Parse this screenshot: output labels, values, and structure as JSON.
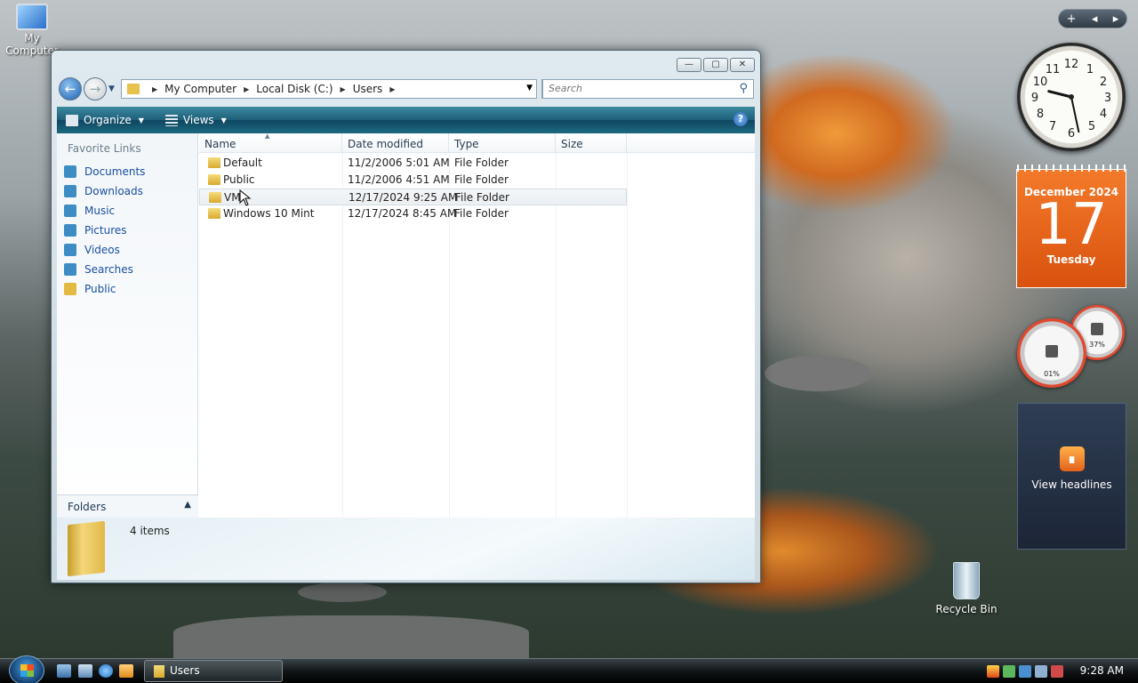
{
  "desktop": {
    "icons": [
      {
        "label": "My Computer"
      },
      {
        "label": "Recycle Bin"
      }
    ]
  },
  "window": {
    "title": "Users",
    "buttons": {
      "minimize": "—",
      "maximize": "▢",
      "close": "✕"
    },
    "address": {
      "crumbs": [
        "My Computer",
        "Local Disk (C:)",
        "Users"
      ]
    },
    "search_placeholder": "Search",
    "toolbar": {
      "organize": "Organize",
      "views": "Views",
      "help": "?"
    },
    "favorite_links": {
      "title": "Favorite Links",
      "items": [
        {
          "label": "Documents",
          "color": "#3d8cc4"
        },
        {
          "label": "Downloads",
          "color": "#3d8cc4"
        },
        {
          "label": "Music",
          "color": "#3d8cc4"
        },
        {
          "label": "Pictures",
          "color": "#3d8cc4"
        },
        {
          "label": "Videos",
          "color": "#3d8cc4"
        },
        {
          "label": "Searches",
          "color": "#3d8cc4"
        },
        {
          "label": "Public",
          "color": "#e3b941"
        }
      ]
    },
    "folders_bar": {
      "label": "Folders"
    },
    "columns": [
      "Name",
      "Date modified",
      "Type",
      "Size"
    ],
    "rows": [
      {
        "name": "Default",
        "date": "11/2/2006 5:01 AM",
        "type": "File Folder",
        "size": ""
      },
      {
        "name": "Public",
        "date": "11/2/2006 4:51 AM",
        "type": "File Folder",
        "size": ""
      },
      {
        "name": "VM",
        "date": "12/17/2024 9:25 AM",
        "type": "File Folder",
        "size": ""
      },
      {
        "name": "Windows 10 Mint",
        "date": "12/17/2024 8:45 AM",
        "type": "File Folder",
        "size": ""
      }
    ],
    "details": {
      "count": "4 items"
    }
  },
  "gadgets": {
    "controls": {
      "add": "+",
      "prev": "◂",
      "next": "▸"
    },
    "clock": {
      "hour": 9,
      "minute": 28
    },
    "calendar": {
      "month_year": "December 2024",
      "day": "17",
      "weekday": "Tuesday"
    },
    "cpu": {
      "cpu": "01%",
      "memory": "37%"
    },
    "feed": {
      "label": "View headlines"
    }
  },
  "taskbar": {
    "task": "Users",
    "time": "9:28 AM"
  }
}
